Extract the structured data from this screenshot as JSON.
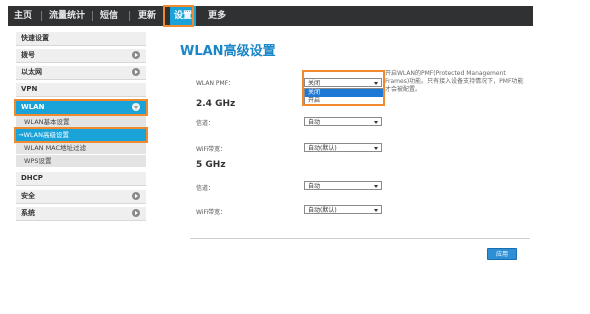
{
  "nav": {
    "items": [
      {
        "label": "主页"
      },
      {
        "label": "流量统计"
      },
      {
        "label": "短信"
      },
      {
        "label": "更新"
      },
      {
        "label": "设置"
      },
      {
        "label": "更多"
      }
    ],
    "active": "设置"
  },
  "sidebar": {
    "items": [
      {
        "label": "快速设置"
      },
      {
        "label": "拨号"
      },
      {
        "label": "以太网"
      },
      {
        "label": "VPN"
      },
      {
        "label": "WLAN"
      },
      {
        "label": "DHCP"
      },
      {
        "label": "安全"
      },
      {
        "label": "系统"
      }
    ],
    "wlan_sub": [
      {
        "label": "WLAN基本设置"
      },
      {
        "label": "→WLAN高级设置"
      },
      {
        "label": "WLAN MAC地址过滤"
      },
      {
        "label": "WPS设置"
      }
    ]
  },
  "main": {
    "title": "WLAN高级设置",
    "pmf_label": "WLAN PMF：",
    "pmf_value": "关闭",
    "pmf_options": [
      "关闭",
      "开启"
    ],
    "help_text": "开启WLAN的PMF(Protected Management Frames)功能。只有接入设备支持情况下，PMF功能才会被配置。",
    "section_24": "2.4 GHz",
    "section_5": "5 GHz",
    "channel_label": "信道：",
    "width_label": "WiFi带宽：",
    "ch24_value": "自动",
    "w24_value": "自动(默认)",
    "ch5_value": "自动",
    "w5_value": "自动(默认)",
    "apply_label": "应用"
  },
  "colors": {
    "accent": "#1aa3d9",
    "highlight": "#f08a2e",
    "topbar": "#2f3133",
    "title": "#1a86c7"
  }
}
